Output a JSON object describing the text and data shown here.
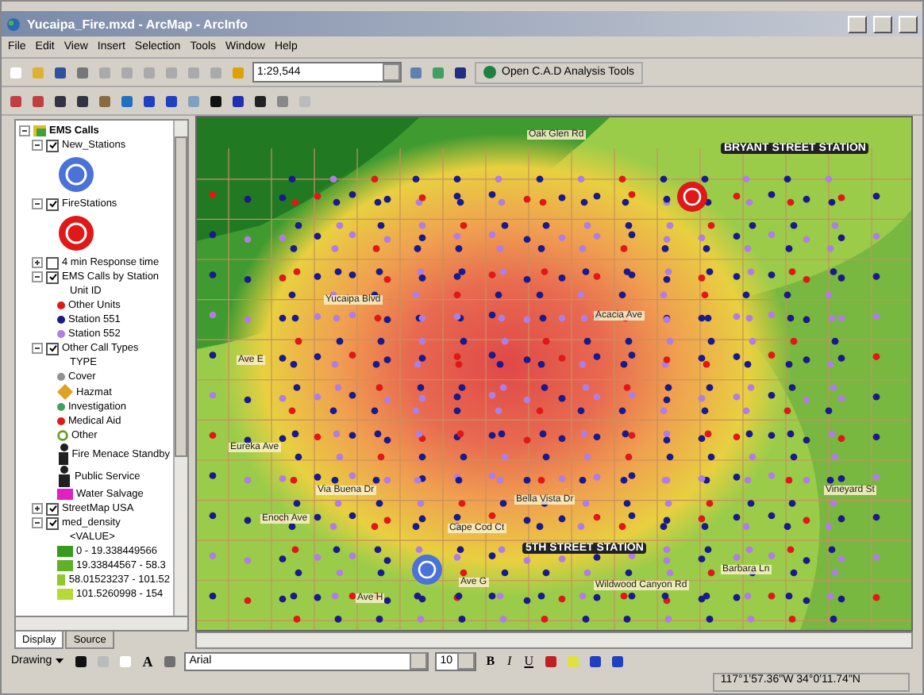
{
  "window": {
    "title": "Yucaipa_Fire.mxd - ArcMap - ArcInfo"
  },
  "menu": [
    "File",
    "Edit",
    "View",
    "Insert",
    "Selection",
    "Tools",
    "Window",
    "Help"
  ],
  "toolbar": {
    "scale": "1:29,544",
    "cad_button": "Open C.A.D Analysis Tools"
  },
  "toc": {
    "layers": [
      {
        "name": "EMS Calls",
        "kind": "group",
        "expanded": true,
        "children": [
          {
            "name": "New_Stations",
            "kind": "layer",
            "checked": true,
            "expanded": true,
            "legend": [
              {
                "kind": "station",
                "color": "#4a72d8"
              }
            ]
          },
          {
            "name": "FireStations",
            "kind": "layer",
            "checked": true,
            "expanded": true,
            "legend": [
              {
                "kind": "station",
                "color": "#e01818"
              }
            ]
          },
          {
            "name": "4 min Response time",
            "kind": "layer",
            "checked": false,
            "expanded": false
          },
          {
            "name": "EMS Calls by Station",
            "kind": "layer",
            "checked": true,
            "expanded": true,
            "field": "Unit ID",
            "legend": [
              {
                "kind": "dot",
                "label": "Other Units",
                "color": "#e01818"
              },
              {
                "kind": "dot",
                "label": "Station 551",
                "color": "#1a1a8a"
              },
              {
                "kind": "dot",
                "label": "Station 552",
                "color": "#b07ee0"
              }
            ]
          },
          {
            "name": "Other Call Types",
            "kind": "layer",
            "checked": true,
            "expanded": true,
            "field": "TYPE",
            "legend": [
              {
                "kind": "dot",
                "label": "Cover",
                "color": "#909090"
              },
              {
                "kind": "hazmat",
                "label": "Hazmat",
                "color": "#e0a020"
              },
              {
                "kind": "dot",
                "label": "Investigation",
                "color": "#40a060"
              },
              {
                "kind": "dot",
                "label": "Medical Aid",
                "color": "#e01818"
              },
              {
                "kind": "ring",
                "label": "Other",
                "color": "#60a020"
              },
              {
                "kind": "figure",
                "label": "Fire Menace Standby",
                "color": "#202020"
              },
              {
                "kind": "figure",
                "label": "Public Service",
                "color": "#202020"
              },
              {
                "kind": "square",
                "label": "Water Salvage",
                "color": "#e020c0"
              }
            ]
          },
          {
            "name": "StreetMap USA",
            "kind": "layer",
            "checked": true,
            "expanded": false
          },
          {
            "name": "med_density",
            "kind": "layer",
            "checked": true,
            "expanded": true,
            "field": "<VALUE>",
            "legend": [
              {
                "kind": "square",
                "label": "0 - 19.338449566",
                "color": "#3a9a20"
              },
              {
                "kind": "square",
                "label": "19.33844567 - 58.3",
                "color": "#60b028"
              },
              {
                "kind": "square",
                "label": "58.01523237 - 101.52",
                "color": "#90c830"
              },
              {
                "kind": "square",
                "label": "101.5260998 - 154",
                "color": "#b8d838"
              }
            ]
          }
        ]
      }
    ],
    "tabs": [
      {
        "label": "Display",
        "selected": true
      },
      {
        "label": "Source",
        "selected": false
      }
    ]
  },
  "map": {
    "stations": [
      {
        "label": "BRYANT STREET STATION",
        "color": "#e01818"
      },
      {
        "label": "5TH STREET STATION",
        "color": "#4a72d8"
      }
    ],
    "streets": [
      "Oak Glen Rd",
      "Yucaipa Blvd",
      "Eureka Ave",
      "Enoch Ave",
      "Via Buena Dr",
      "Bella Vista Dr",
      "Cape Cod Ct",
      "Ave G",
      "Ave H",
      "Vineyard St",
      "Barbara Ln",
      "Wildwood Canyon Rd",
      "Ave E",
      "Acacia Ave"
    ]
  },
  "drawing": {
    "menu": "Drawing",
    "text_tool": "A",
    "font": "Arial",
    "size": "10",
    "format": [
      "B",
      "I",
      "U"
    ]
  },
  "status_bar": {
    "coordinates": "117°1'57.36\"W 34°0'11.74\"N"
  }
}
